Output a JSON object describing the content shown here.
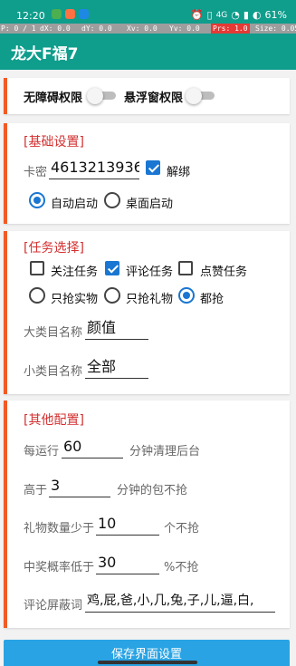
{
  "statusbar": {
    "time": "12:20",
    "right_text": "61%",
    "icons": [
      "message-icon",
      "sound-icon",
      "app-icon",
      "alarm-icon",
      "vibrate-icon",
      "nfc-icon",
      "signal-icon",
      "wifi-icon",
      "sim-icon",
      "battery-icon"
    ],
    "network": "4G",
    "left_icon_colors": [
      "#4caf50",
      "#ff7043",
      "#1e88e5"
    ]
  },
  "debug": {
    "p": "P: 0 / 1",
    "dx": "dX: 0.0",
    "dy": "dY: 0.0",
    "xv": "Xv: 0.0",
    "yv": "Yv: 0.0",
    "prs": "Prs: 1.0",
    "size": "Size: 0.05"
  },
  "app": {
    "title": "龙大F福7"
  },
  "permissions": {
    "accessibility_label": "无障碍权限",
    "overlay_label": "悬浮窗权限"
  },
  "basic": {
    "title": "[基础设置]",
    "card_label": "卡密",
    "card_value": "4613213936",
    "unbind_label": "解绑",
    "auto_start_label": "自动启动",
    "desktop_start_label": "桌面启动"
  },
  "tasks": {
    "title": "[任务选择]",
    "follow_label": "关注任务",
    "comment_label": "评论任务",
    "like_label": "点赞任务",
    "only_item_label": "只抢实物",
    "only_gift_label": "只抢礼物",
    "all_label": "都抢",
    "major_label": "大类目名称",
    "major_value": "颜值",
    "minor_label": "小类目名称",
    "minor_value": "全部"
  },
  "other": {
    "title": "[其他配置]",
    "run_prefix": "每运行",
    "run_value": "60",
    "run_suffix": "分钟清理后台",
    "above_prefix": "高于",
    "above_value": "3",
    "above_suffix": "分钟的包不抢",
    "gift_prefix": "礼物数量少于",
    "gift_value": "10",
    "gift_suffix": "个不抢",
    "prob_prefix": "中奖概率低于",
    "prob_value": "30",
    "prob_suffix": "%不抢",
    "block_label": "评论屏蔽词",
    "block_value": "鸡,屁,爸,小,几,兔,子,儿,逼,白,"
  },
  "save_button": "保存界面设置",
  "colors": {
    "primary": "#0f9d8c",
    "section_title": "#d32f2f",
    "accent_border": "#f15a24",
    "check_blue": "#1976d2",
    "save_button": "#29a3e4"
  }
}
